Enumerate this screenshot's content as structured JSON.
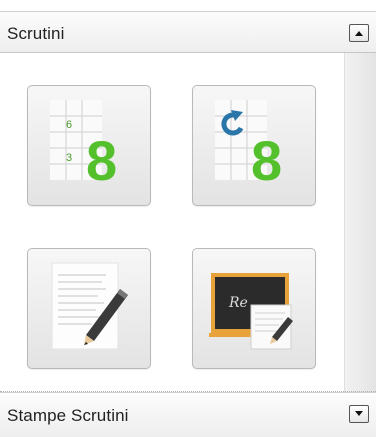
{
  "sections": {
    "scrutini": {
      "title": "Scrutini",
      "state": "expanded"
    },
    "stampe": {
      "title": "Stampe Scrutini",
      "state": "collapsed"
    }
  },
  "tiles": {
    "grades_grid": {
      "icon": "grade-grid-icon",
      "small_numbers": [
        "6",
        "3"
      ],
      "big_number": "8"
    },
    "grades_refresh": {
      "icon": "grade-refresh-icon",
      "big_number": "8"
    },
    "notes": {
      "icon": "document-pencil-icon"
    },
    "blackboard": {
      "icon": "blackboard-report-icon",
      "board_text": "Re"
    }
  },
  "colors": {
    "accent_green": "#54c02c",
    "refresh_blue": "#2a76a8",
    "board": "#2b2b2b",
    "board_frame": "#e7a23a"
  }
}
